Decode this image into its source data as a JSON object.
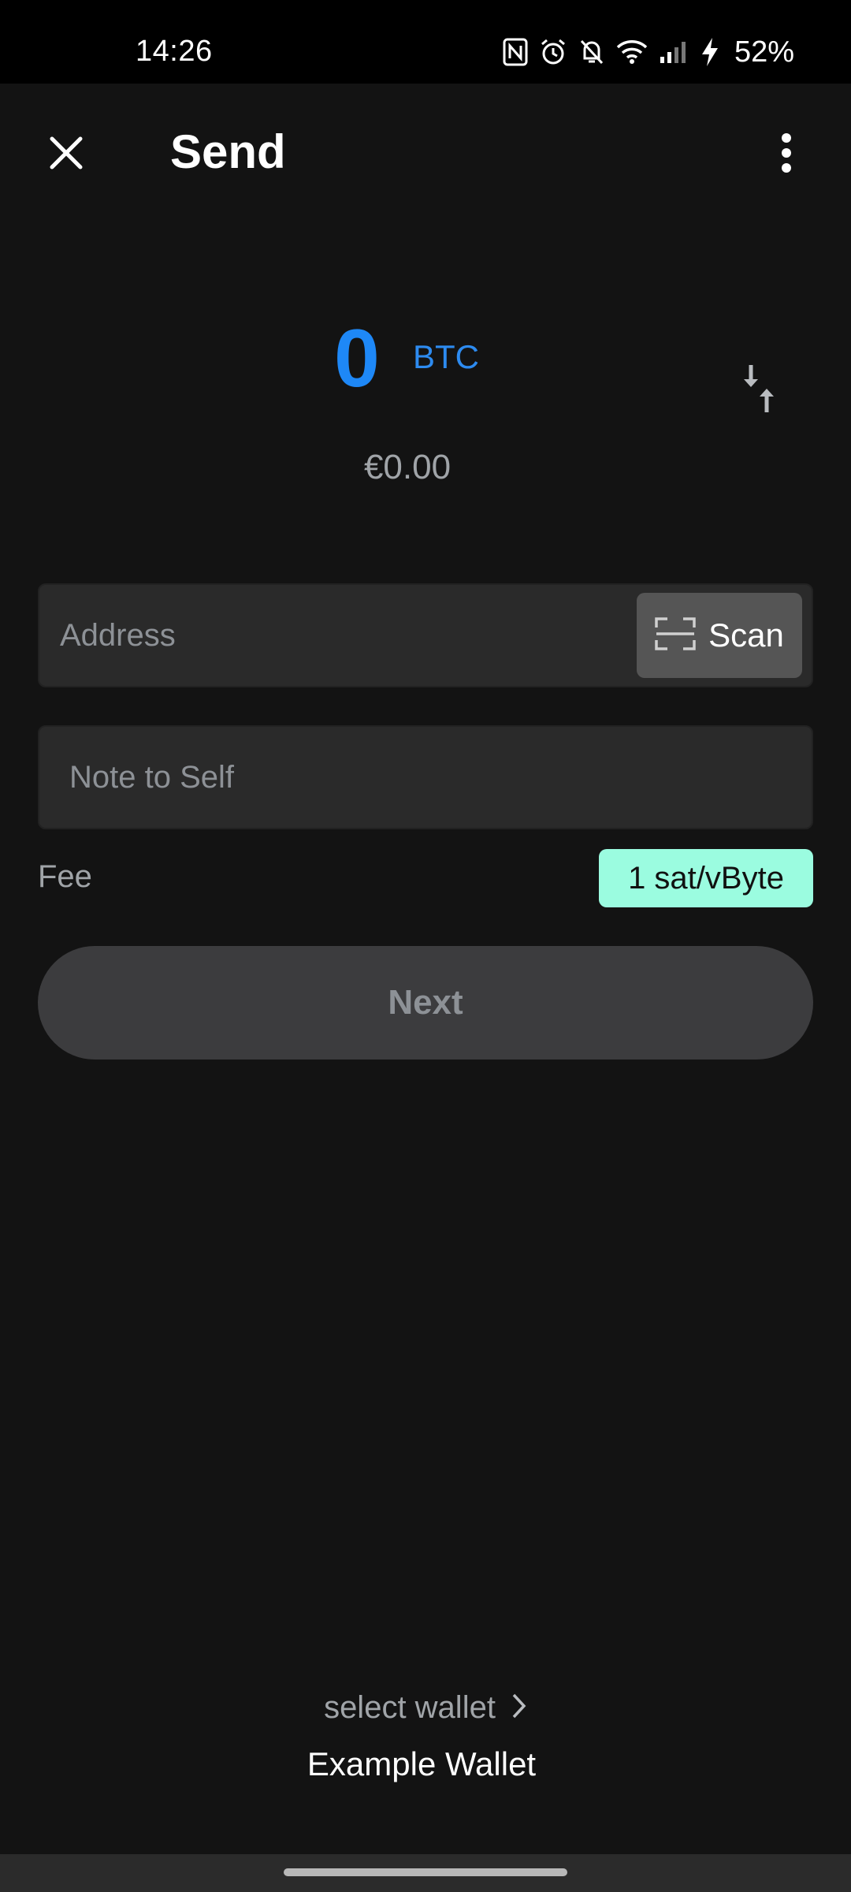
{
  "status_bar": {
    "time": "14:26",
    "battery": "52%",
    "icons": [
      "nfc-icon",
      "alarm-icon",
      "bell-off-icon",
      "wifi-icon",
      "signal-icon",
      "charging-icon"
    ]
  },
  "header": {
    "title": "Send",
    "close_icon": "close-icon",
    "more_icon": "more-vert-icon"
  },
  "amount": {
    "value": "0",
    "unit": "BTC",
    "fiat": "€0.00",
    "swap_icon": "swap-vert-icon"
  },
  "address": {
    "placeholder": "Address",
    "value": "",
    "scan_label": "Scan"
  },
  "note": {
    "placeholder": "Note to Self",
    "value": ""
  },
  "fee": {
    "label": "Fee",
    "value": "1 sat/vByte"
  },
  "next_button": {
    "label": "Next",
    "enabled": false
  },
  "wallet": {
    "select_label": "select wallet",
    "name": "Example Wallet"
  },
  "colors": {
    "background": "#131313",
    "accent_blue": "#1e88f7",
    "fee_badge": "#9bfce0",
    "field_bg": "#2a2a2a"
  }
}
